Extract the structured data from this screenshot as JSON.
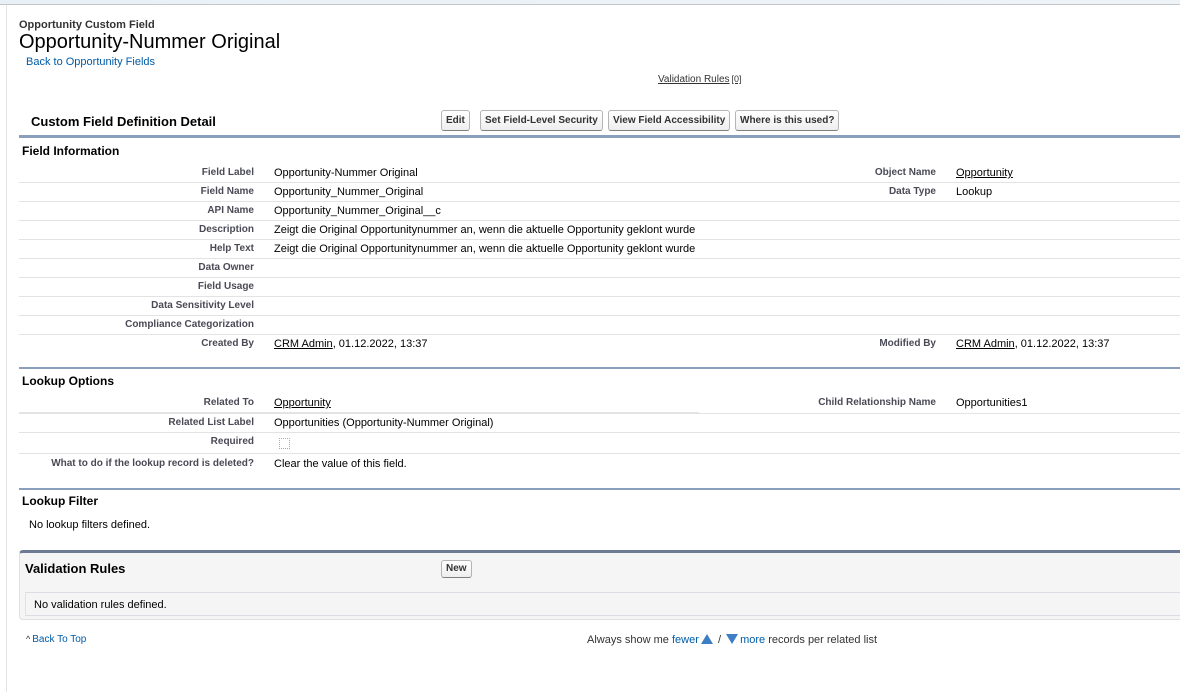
{
  "header": {
    "subtitle": "Opportunity Custom Field",
    "title": "Opportunity-Nummer Original",
    "back_link": "Back to Opportunity Fields",
    "validation_rules_link": "Validation Rules",
    "validation_rules_count": "[0]"
  },
  "detail": {
    "title": "Custom Field Definition Detail",
    "buttons": {
      "edit": "Edit",
      "set_fls": "Set Field-Level Security",
      "view_access": "View Field Accessibility",
      "where_used": "Where is this used?"
    }
  },
  "field_information": {
    "heading": "Field Information",
    "rows": [
      {
        "label": "Field Label",
        "value": "Opportunity-Nummer Original",
        "label2": "Object Name",
        "value2": "Opportunity"
      },
      {
        "label": "Field Name",
        "value": "Opportunity_Nummer_Original",
        "label2": "Data Type",
        "value2": "Lookup"
      },
      {
        "label": "API Name",
        "value": "Opportunity_Nummer_Original__c"
      },
      {
        "label": "Description",
        "value": "Zeigt die Original Opportunitynummer an, wenn die aktuelle Opportunity geklont wurde"
      },
      {
        "label": "Help Text",
        "value": "Zeigt die Original Opportunitynummer an, wenn die aktuelle Opportunity geklont wurde"
      },
      {
        "label": "Data Owner",
        "value": ""
      },
      {
        "label": "Field Usage",
        "value": ""
      },
      {
        "label": "Data Sensitivity Level",
        "value": ""
      },
      {
        "label": "Compliance Categorization",
        "value": ""
      }
    ],
    "created_by": {
      "label": "Created By",
      "user": "CRM Admin",
      "date": ", 01.12.2022, 13:37"
    },
    "modified_by": {
      "label": "Modified By",
      "user": "CRM Admin",
      "date": ", 01.12.2022, 13:37"
    }
  },
  "lookup_options": {
    "heading": "Lookup Options",
    "related_to": {
      "label": "Related To",
      "value": "Opportunity"
    },
    "child_relationship": {
      "label": "Child Relationship Name",
      "value": "Opportunities1"
    },
    "related_list_label": {
      "label": "Related List Label",
      "value": "Opportunities (Opportunity-Nummer Original)"
    },
    "required": {
      "label": "Required",
      "checked": false
    },
    "on_delete": {
      "label": "What to do if the lookup record is deleted?",
      "value": "Clear the value of this field."
    }
  },
  "lookup_filter": {
    "heading": "Lookup Filter",
    "empty": "No lookup filters defined."
  },
  "validation_rules": {
    "title": "Validation Rules",
    "new_button": "New",
    "empty": "No validation rules defined."
  },
  "footer": {
    "back_to_top": "Back To Top",
    "always_show": "Always show me",
    "fewer": "fewer",
    "separator": "/",
    "more": "more",
    "suffix": "records per related list"
  }
}
